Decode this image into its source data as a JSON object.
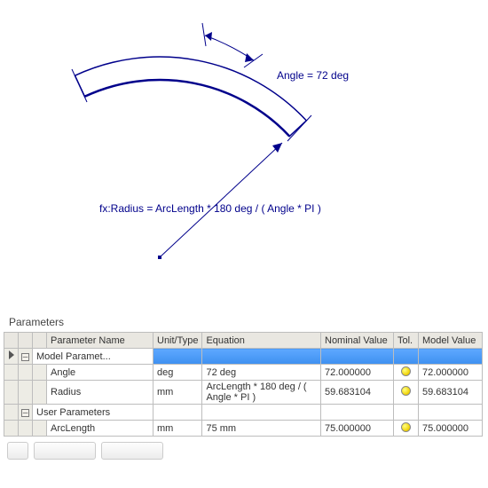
{
  "sketch": {
    "angle_label": "Angle = 72 deg",
    "radius_label": "fx:Radius = ArcLength * 180 deg / ( Angle * PI )"
  },
  "panel": {
    "title": "Parameters",
    "columns": {
      "name": "Parameter Name",
      "unit": "Unit/Type",
      "equation": "Equation",
      "nominal": "Nominal Value",
      "tol": "Tol.",
      "model": "Model Value"
    },
    "groups": {
      "model": "Model Paramet...",
      "user": "User Parameters"
    },
    "rows": [
      {
        "name": "Angle",
        "unit": "deg",
        "equation": "72 deg",
        "nominal": "72.000000",
        "tol": true,
        "model": "72.000000"
      },
      {
        "name": "Radius",
        "unit": "mm",
        "equation": "ArcLength * 180 deg / ( Angle * PI )",
        "nominal": "59.683104",
        "tol": true,
        "model": "59.683104"
      },
      {
        "name": "ArcLength",
        "unit": "mm",
        "equation": "75 mm",
        "nominal": "75.000000",
        "tol": true,
        "model": "75.000000"
      }
    ]
  }
}
